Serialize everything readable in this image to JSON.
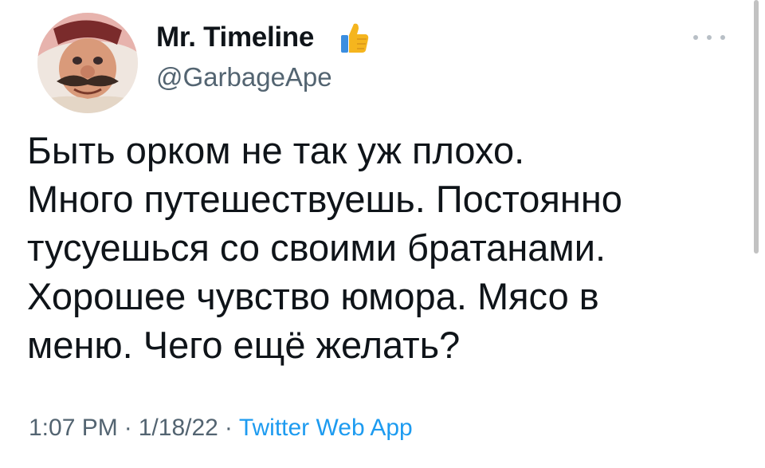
{
  "author": {
    "display_name": "Mr. Timeline",
    "handle": "@GarbageApe",
    "badge_icon": "thumbs-up-icon",
    "avatar_description": "cartoon mustached man avatar"
  },
  "tweet": {
    "text": "Быть орком не так уж плохо.\nМного путешествуешь. Постоянно\nтусуешься со своими братанами.\nХорошее чувство юмора. Мясо в\nменю. Чего ещё желать?"
  },
  "meta": {
    "time": "1:07 PM",
    "separator": "·",
    "date": "1/18/22",
    "source": "Twitter Web App"
  },
  "colors": {
    "text": "#0f1419",
    "secondary": "#536471",
    "link": "#1d9bf0",
    "thumb": "#f5b51e"
  }
}
